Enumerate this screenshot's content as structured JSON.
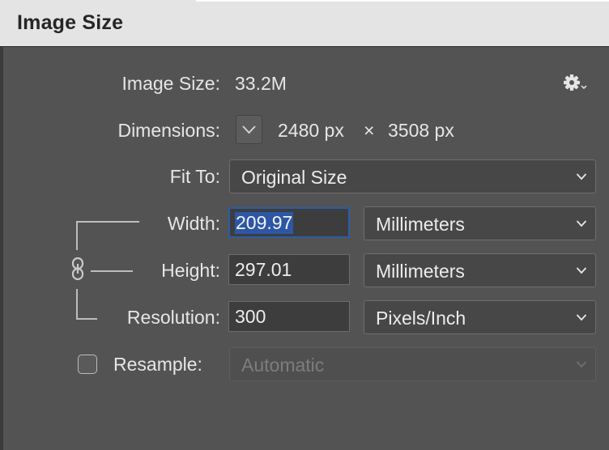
{
  "dialog": {
    "title": "Image Size"
  },
  "image_size": {
    "label": "Image Size:",
    "value": "33.2M"
  },
  "dimensions": {
    "label": "Dimensions:",
    "width_value": "2480 px",
    "separator": "×",
    "height_value": "3508 px"
  },
  "fit_to": {
    "label": "Fit To:",
    "selected": "Original Size"
  },
  "width": {
    "label": "Width:",
    "value": "209.97",
    "unit": "Millimeters"
  },
  "height": {
    "label": "Height:",
    "value": "297.01",
    "unit": "Millimeters"
  },
  "resolution": {
    "label": "Resolution:",
    "value": "300",
    "unit": "Pixels/Inch"
  },
  "resample": {
    "label": "Resample:",
    "checked": false,
    "selected": "Automatic",
    "enabled": false
  },
  "icons": [
    "gear-icon",
    "chevron-down-icon",
    "link-icon"
  ],
  "colors": {
    "selection": "#2d57a6",
    "panel": "#535353",
    "titlebar": "#e4e4e4"
  }
}
